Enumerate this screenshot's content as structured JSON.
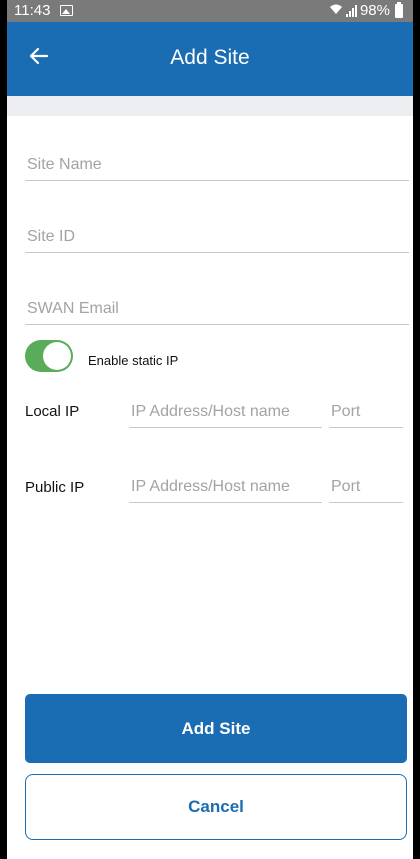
{
  "status_bar": {
    "time": "11:43",
    "battery": "98%",
    "icons": [
      "gallery-icon",
      "wifi-icon",
      "signal-icon",
      "battery-icon"
    ]
  },
  "app_bar": {
    "title": "Add Site",
    "back_icon": "arrow-left-icon"
  },
  "form": {
    "site_name": {
      "placeholder": "Site Name",
      "value": ""
    },
    "site_id": {
      "placeholder": "Site ID",
      "value": ""
    },
    "swan_email": {
      "placeholder": "SWAN Email",
      "value": ""
    },
    "static_ip": {
      "label": "Enable static IP",
      "enabled": true
    },
    "local_ip": {
      "label": "Local IP",
      "host_placeholder": "IP Address/Host name",
      "port_placeholder": "Port"
    },
    "public_ip": {
      "label": "Public IP",
      "host_placeholder": "IP Address/Host name",
      "port_placeholder": "Port"
    }
  },
  "actions": {
    "add_site_label": "Add Site",
    "cancel_label": "Cancel"
  },
  "colors": {
    "primary": "#1a6db3",
    "toggle_on": "#5aab5a",
    "status_bar": "#7a7a7a",
    "subbar": "#eceef2"
  }
}
